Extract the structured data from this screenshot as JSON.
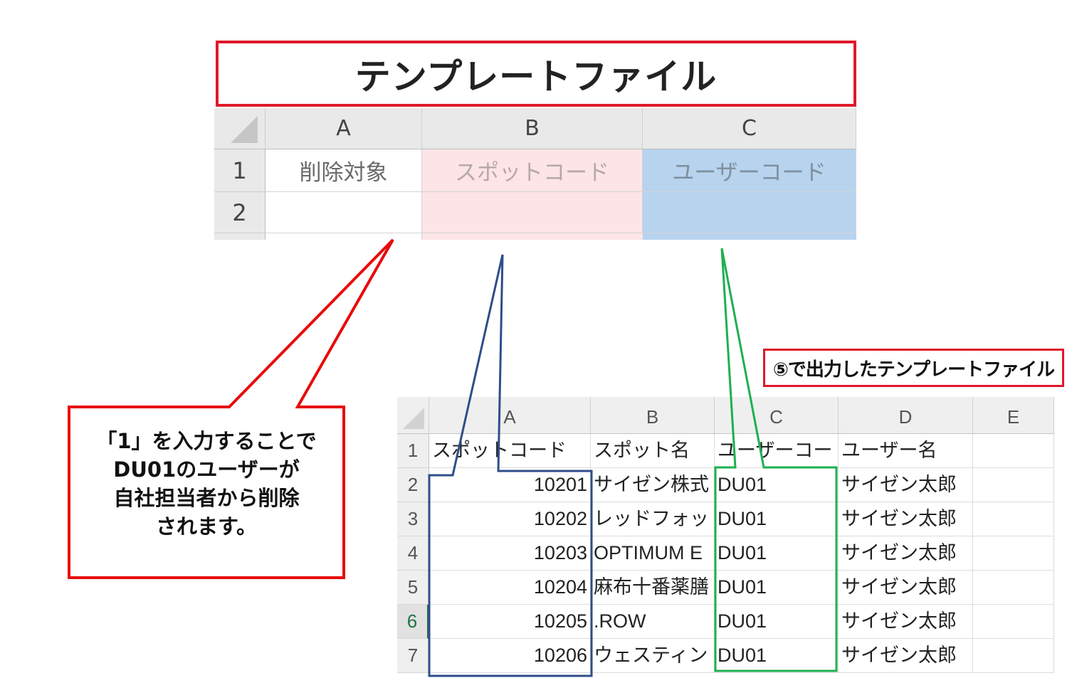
{
  "template": {
    "title": "テンプレートファイル",
    "columns": [
      "A",
      "B",
      "C"
    ],
    "rows": [
      "1",
      "2"
    ],
    "row1": [
      "削除対象",
      "スポットコード",
      "ユーザーコード"
    ],
    "colors": {
      "b_fill": "#fde4e6",
      "c_fill": "#b7d3ee",
      "title_border": "#e0182b"
    }
  },
  "callout": {
    "lines": [
      "「1」を入力することで",
      "DU01のユーザーが",
      "自社担当者から削除",
      "されます。"
    ],
    "border_color": "#e80c0c"
  },
  "output_label": "⑤で出力したテンプレートファイル",
  "output_sheet": {
    "columns": [
      "A",
      "B",
      "C",
      "D",
      "E"
    ],
    "row_numbers": [
      "1",
      "2",
      "3",
      "4",
      "5",
      "6",
      "7"
    ],
    "active_row": "6",
    "header_row": [
      "スポットコード",
      "スポット名",
      "ユーザーコー",
      "ユーザー名",
      ""
    ],
    "rows": [
      [
        "10201",
        "サイゼン株式",
        "DU01",
        "サイゼン太郎"
      ],
      [
        "10202",
        "レッドフォッ",
        "DU01",
        "サイゼン太郎"
      ],
      [
        "10203",
        "OPTIMUM E",
        "DU01",
        "サイゼン太郎"
      ],
      [
        "10204",
        "麻布十番薬膳",
        "DU01",
        "サイゼン太郎"
      ],
      [
        "10205",
        ".ROW",
        "DU01",
        "サイゼン太郎"
      ],
      [
        "10206",
        "ウェスティン",
        "DU01",
        "サイゼン太郎"
      ]
    ]
  },
  "connector_colors": {
    "spot": "#2e4d8a",
    "user": "#1db04e"
  }
}
